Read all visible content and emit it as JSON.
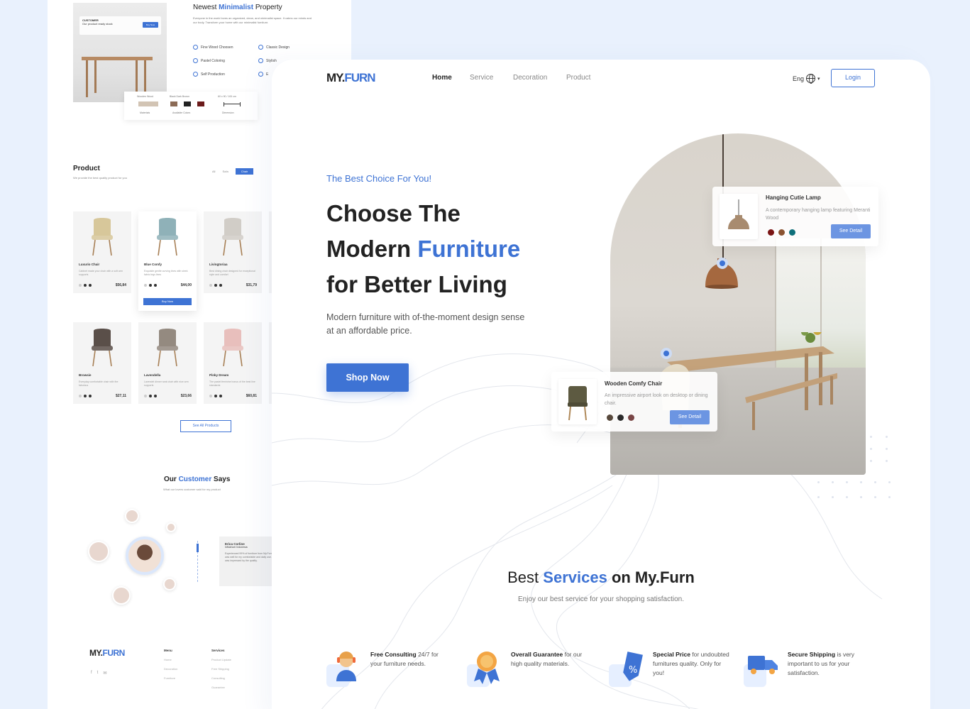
{
  "back": {
    "prop_tip_title": "CUSTOMER",
    "prop_tip_text": "Our product ready stock",
    "prop_tip_button": "Buy Now",
    "property": {
      "title_before": "Newest",
      "title_highlight": "Minimalist",
      "title_after": "Property",
      "desc": "Everyone in the world loves an organized, clean, and minimalist space. It calms our minds and our body. Transform your home with our minimalist furniture.",
      "features": [
        "Fine Wood Choosen",
        "Classic Design",
        "Pastel Coloring",
        "Stylish",
        "Self Production",
        "E"
      ]
    },
    "swatches": {
      "label_wood": "Wooden Wood",
      "label_color": "Black  Dark  Brown",
      "label_size": "60 x 90 / 100 cm",
      "caption_wood": "Materials",
      "caption_color": "Available Colors",
      "caption_size": "Dimension",
      "colors": [
        "#d2c4b4",
        "#8b6b56",
        "#222222",
        "#6b1a1a"
      ]
    },
    "products": {
      "title": "Product",
      "subtitle": "We provide the best quality product for you",
      "tabs": [
        "All",
        "Sofa",
        "Chair"
      ],
      "items": [
        {
          "name": "Luxurio Chair",
          "desc": "Cabinet made your chair with a soft arm supports",
          "price": "$56,84",
          "color": "#d7c79a"
        },
        {
          "name": "Blue Comfy",
          "desc": "Exquisite gentle curving lines with sleek fabric legs lines",
          "price": "$44,00",
          "color": "#8fb1b8"
        },
        {
          "name": "Livingtoriaa",
          "desc": "Best dining chair designed for exceptional style and comfort",
          "price": "$31,79",
          "color": "#d1cdc7"
        },
        {
          "name": "Browsie",
          "desc": "Everyday comfortable chair with the fabulous",
          "price": "$27,11",
          "color": "#5a4f49"
        },
        {
          "name": "Lavendella",
          "desc": "Lavendel dinner seat chair with nice arm supports",
          "price": "$23,66",
          "color": "#948a80"
        },
        {
          "name": "Pinky Dream",
          "desc": "The pastel feminine bonus of the best line standards",
          "price": "$60,81",
          "color": "#e8bfbc"
        }
      ],
      "buy_label": "Buy Now",
      "see_all": "See All Products"
    },
    "customers": {
      "title_before": "Our",
      "title_highlight": "Customer",
      "title_after": "Says",
      "subtitle": "What our lovers customer said for my product",
      "quote_name": "Erica Corline",
      "quote_role": "Influencer Indonesia",
      "quote_text": "Experienced 99% of furniture from My.Furn that was well for my comfortable and daily use. I was impressed by the quality."
    },
    "footer": {
      "logo_a": "MY.",
      "logo_b": "FURN",
      "social": [
        "f",
        "t",
        "✉"
      ],
      "menu_title": "Menu",
      "menu": [
        "Home",
        "Decoration",
        "Furniture"
      ],
      "services_title": "Services",
      "services": [
        "Product Update",
        "Free Shipping",
        "Consulting",
        "Guarantee"
      ]
    }
  },
  "front": {
    "logo_a": "MY.",
    "logo_b": "FURN",
    "nav": [
      "Home",
      "Service",
      "Decoration",
      "Product"
    ],
    "lang": "Eng",
    "login": "Login",
    "hero": {
      "tagline": "The Best Choice For You!",
      "line1": "Choose The",
      "line2_before": "Modern",
      "line2_highlight": "Furniture",
      "line3": "for Better Living",
      "subtext": "Modern furniture with of-the-moment design sense at an affordable price.",
      "cta": "Shop Now"
    },
    "lamp_card": {
      "title": "Hanging Cutie Lamp",
      "desc": "A contemporary hanging lamp featuring Meranti Wood",
      "button": "See Detail",
      "colors": [
        "#7a1414",
        "#8a5230",
        "#0f6f7a"
      ]
    },
    "chair_card": {
      "title": "Wooden Comfy Chair",
      "desc": "An impressive airport look on desktop or dining chair.",
      "button": "See Detail",
      "colors": [
        "#58493c",
        "#2a2a2a",
        "#7a4646"
      ]
    },
    "services": {
      "title_before": "Best",
      "title_highlight": "Services",
      "title_after": "on My.Furn",
      "subtitle": "Enjoy our best service for your shopping satisfaction.",
      "items": [
        {
          "bold": "Free Consulting",
          "rest": " 24/7 for your furniture needs."
        },
        {
          "bold": "Overall Guarantee",
          "rest": " for our high quality materials."
        },
        {
          "bold": "Special Price",
          "rest": " for undoubted furnitures quality. Only for you!"
        },
        {
          "bold": "Secure Shipping",
          "rest": " is very important to us for your satisfaction."
        }
      ]
    }
  },
  "accent": "#3e73d4"
}
